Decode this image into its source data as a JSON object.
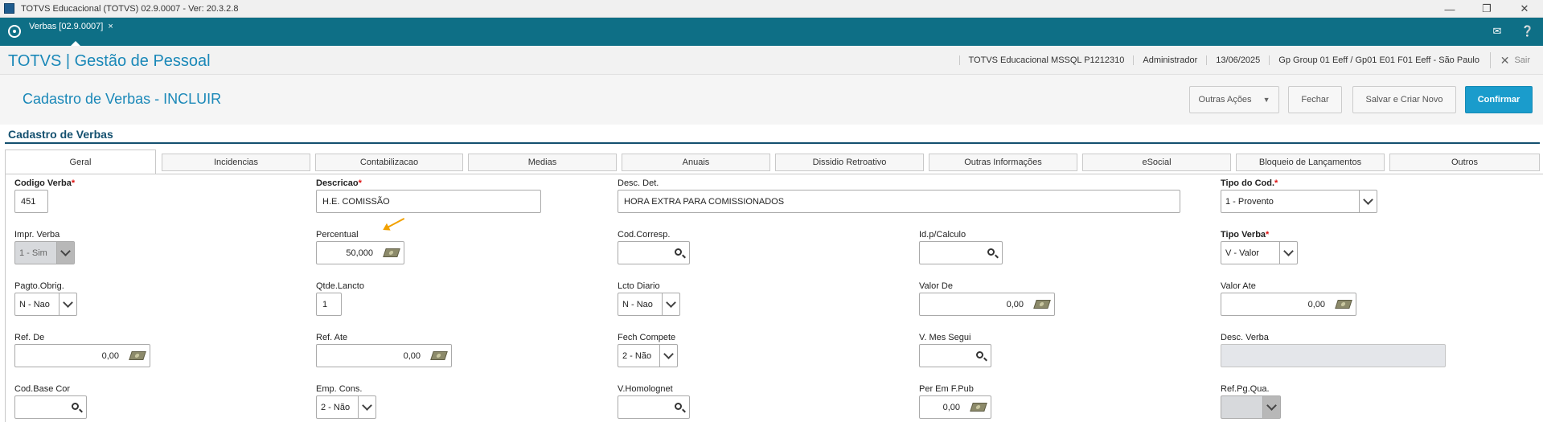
{
  "window": {
    "title": "TOTVS Educacional (TOTVS) 02.9.0007 - Ver: 20.3.2.8",
    "minimize_icon": "minimize-icon",
    "restore_icon": "restore-icon",
    "close_icon": "close-icon"
  },
  "tabstrip": {
    "active_tab": "Verbas [02.9.0007]",
    "close_glyph": "×",
    "mail_icon": "mail-icon",
    "help_icon": "help-icon"
  },
  "header": {
    "brand": "TOTVS | Gestão de Pessoal",
    "environment": "TOTVS Educacional MSSQL P1212310",
    "user": "Administrador",
    "date": "13/06/2025",
    "company": "Gp Group 01 Eeff / Gp01 E01 F01 Eeff - São Paulo",
    "logout": "Sair"
  },
  "page": {
    "title": "Cadastro de Verbas - INCLUIR",
    "buttons": {
      "other_actions": "Outras Ações",
      "close": "Fechar",
      "save_new": "Salvar e Criar Novo",
      "confirm": "Confirmar"
    },
    "section_title": "Cadastro de Verbas"
  },
  "tabs": [
    "Geral",
    "Incidencias",
    "Contabilizacao",
    "Medias",
    "Anuais",
    "Dissidio Retroativo",
    "Outras Informações",
    "eSocial",
    "Bloqueio de Lançamentos",
    "Outros"
  ],
  "required_mark": "*",
  "fields": {
    "codigo_verba": {
      "label": "Codigo Verba",
      "value": "451"
    },
    "descricao": {
      "label": "Descricao",
      "value": "H.E. COMISSÃO"
    },
    "desc_det": {
      "label": "Desc. Det.",
      "value": "HORA EXTRA PARA COMISSIONADOS"
    },
    "tipo_cod": {
      "label": "Tipo do Cod.",
      "value": "1 - Provento"
    },
    "impr_verba": {
      "label": "Impr. Verba",
      "value": "1 - Sim"
    },
    "percentual": {
      "label": "Percentual",
      "value": "50,000"
    },
    "cod_corresp": {
      "label": "Cod.Corresp.",
      "value": ""
    },
    "id_calculo": {
      "label": "Id.p/Calculo",
      "value": ""
    },
    "tipo_verba": {
      "label": "Tipo Verba",
      "value": "V - Valor"
    },
    "pagto_obrig": {
      "label": "Pagto.Obrig.",
      "value": "N - Nao"
    },
    "qtde_lancto": {
      "label": "Qtde.Lancto",
      "value": "1"
    },
    "lcto_diario": {
      "label": "Lcto Diario",
      "value": "N - Nao"
    },
    "valor_de": {
      "label": "Valor De",
      "value": "0,00"
    },
    "valor_ate": {
      "label": "Valor Ate",
      "value": "0,00"
    },
    "ref_de": {
      "label": "Ref. De",
      "value": "0,00"
    },
    "ref_ate": {
      "label": "Ref. Ate",
      "value": "0,00"
    },
    "fech_compete": {
      "label": "Fech Compete",
      "value": "2 - Não"
    },
    "v_mes_segui": {
      "label": "V. Mes Segui",
      "value": ""
    },
    "desc_verba": {
      "label": "Desc. Verba",
      "value": ""
    },
    "cod_base_cor": {
      "label": "Cod.Base Cor",
      "value": ""
    },
    "emp_cons": {
      "label": "Emp. Cons.",
      "value": "2 - Não"
    },
    "v_homolognet": {
      "label": "V.Homolognet",
      "value": ""
    },
    "per_em_fpub": {
      "label": "Per Em F.Pub",
      "value": "0,00"
    },
    "ref_pg_qua": {
      "label": "Ref.Pg.Qua.",
      "value": ""
    }
  },
  "icons": {
    "money": "money-icon",
    "search": "search-icon",
    "dropdown": "chevron-down-icon",
    "annotation": "annotation-arrow"
  },
  "colors": {
    "tabstrip": "#0e6f86",
    "brand": "#1a88b8",
    "primary_button": "#1a9ccc",
    "section": "#14506f",
    "required": "#dd1111",
    "annotation": "#f2a100"
  }
}
